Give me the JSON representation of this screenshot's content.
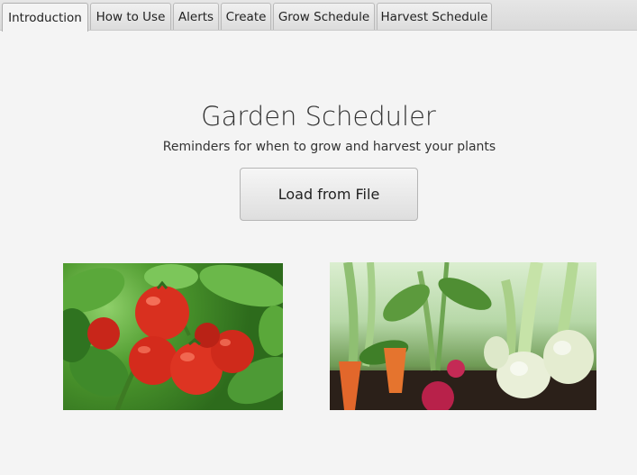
{
  "tabs": [
    {
      "label": "Introduction",
      "active": true
    },
    {
      "label": "How to Use",
      "active": false
    },
    {
      "label": "Alerts",
      "active": false
    },
    {
      "label": "Create",
      "active": false
    },
    {
      "label": "Grow Schedule",
      "active": false
    },
    {
      "label": "Harvest Schedule",
      "active": false
    }
  ],
  "main": {
    "title": "Garden Scheduler",
    "subtitle": "Reminders for when to grow and harvest your plants",
    "load_button_label": "Load from File"
  },
  "images": [
    {
      "name": "tomatoes-photo"
    },
    {
      "name": "vegetables-photo"
    }
  ],
  "colors": {
    "background": "#f4f4f4",
    "tabbar": "#dddddd",
    "tomato": "#d9301f",
    "leaf": "#3f8a2a"
  }
}
